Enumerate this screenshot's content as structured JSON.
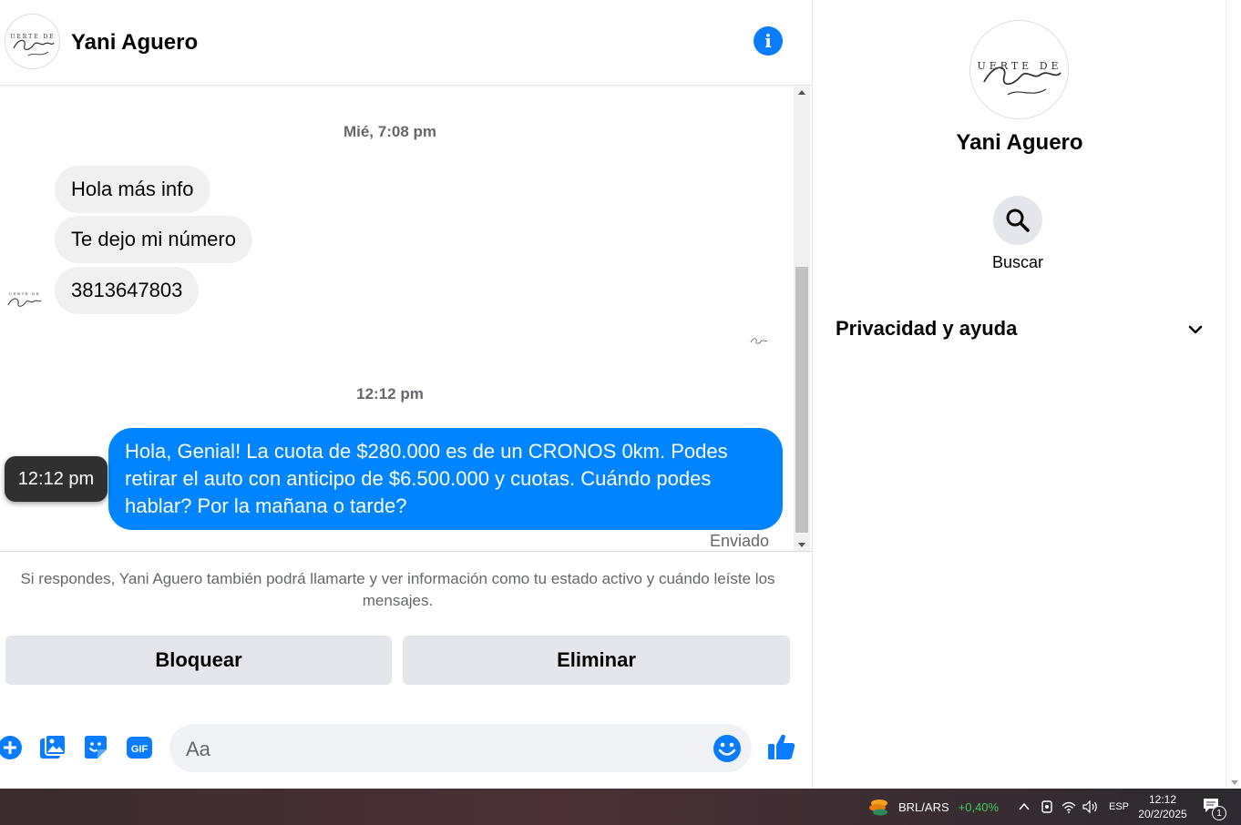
{
  "conversation": {
    "name": "Yani Aguero",
    "avatar_text": "UERTE DE Corazón",
    "timestamps": [
      "Mié, 7:08 pm",
      "12:12 pm"
    ],
    "incoming_messages": [
      "Hola más info",
      "Te dejo mi número",
      "3813647803"
    ],
    "outgoing_message": "Hola, Genial! La cuota de $280.000 es de un CRONOS 0km. Podes retirar el auto con anticipo de $6.500.000 y cuotas. Cuándo podes hablar? Por la mañana o tarde?",
    "hover_tooltip": "12:12 pm",
    "status": "Enviado"
  },
  "notice": "Si respondes, Yani Aguero también podrá llamarte y ver información como tu estado activo y cuándo leíste los mensajes.",
  "actions": {
    "block": "Bloquear",
    "delete": "Eliminar"
  },
  "composer": {
    "placeholder": "Aa",
    "gif_label": "GIF"
  },
  "info_panel": {
    "name": "Yani Aguero",
    "search_label": "Buscar",
    "privacy_label": "Privacidad y ayuda"
  },
  "taskbar": {
    "ticker": "BRL/ARS",
    "ticker_change": "+0,40%",
    "language": "ESP",
    "time": "12:12",
    "date": "20/2/2025",
    "notifications": "1"
  },
  "colors": {
    "accent": "#0084ff",
    "icon_blue": "#0a7cff",
    "ticker_green": "#3ec95b",
    "bubble_gray": "#f0f0f0"
  }
}
